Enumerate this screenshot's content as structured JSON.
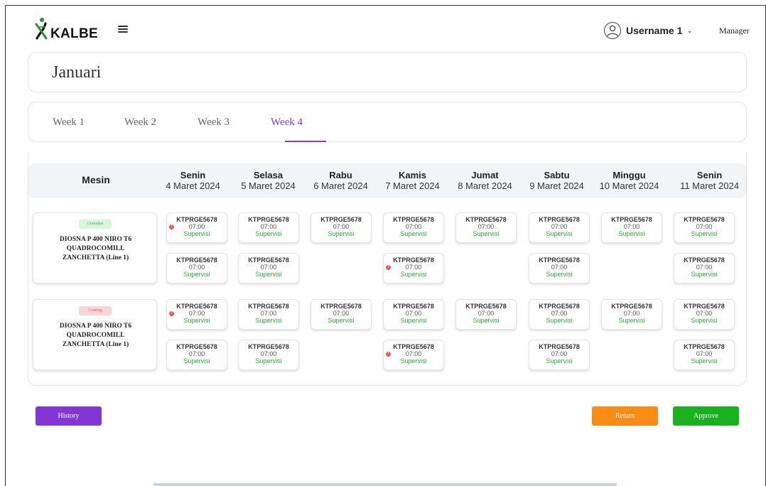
{
  "header": {
    "logo_text": "KALBE",
    "username": "Username 1",
    "role": "Manager"
  },
  "month": {
    "title": "Januari"
  },
  "weeks": [
    "Week 1",
    "Week 2",
    "Week 3",
    "Week 4"
  ],
  "active_week": "Week 4",
  "table": {
    "machine_header": "Mesin",
    "days": [
      {
        "name": "Senin",
        "date": "4 Maret 2024"
      },
      {
        "name": "Selasa",
        "date": "5 Maret 2024"
      },
      {
        "name": "Rabu",
        "date": "6 Maret 2024"
      },
      {
        "name": "Kamis",
        "date": "7 Maret 2024"
      },
      {
        "name": "Jumat",
        "date": "8 Maret 2024"
      },
      {
        "name": "Sabtu",
        "date": "9 Maret 2024"
      },
      {
        "name": "Minggu",
        "date": "10 Maret 2024"
      },
      {
        "name": "Senin",
        "date": "11 Maret 2024"
      }
    ],
    "machines": [
      {
        "badge": "Granulasi",
        "badge_color": "#4caf50",
        "name_lines": [
          "DIOSNA P 400 NIRO T6",
          "QUADROCOMILL",
          "ZANCHETTA (Line 1)"
        ]
      },
      {
        "badge": "Coating",
        "badge_color": "#e06666",
        "name_lines": [
          "DIOSNA P 400 NIRO T6",
          "QUADROCOMILL",
          "ZANCHETTA (Line 1)"
        ]
      }
    ],
    "slot": {
      "code": "KTPRGE5678",
      "time": "07:00",
      "status": "Supervisi",
      "warning_icon": "exclamation-circle-icon"
    }
  },
  "buttons": {
    "history": "History",
    "return": "Return",
    "approve": "Approve"
  },
  "colors": {
    "accent": "#7a3fd6",
    "history": "#8436d4",
    "return": "#fb8c13",
    "approve": "#19b21e",
    "status_green": "#2eaa3a",
    "warning": "#e05a5a"
  }
}
